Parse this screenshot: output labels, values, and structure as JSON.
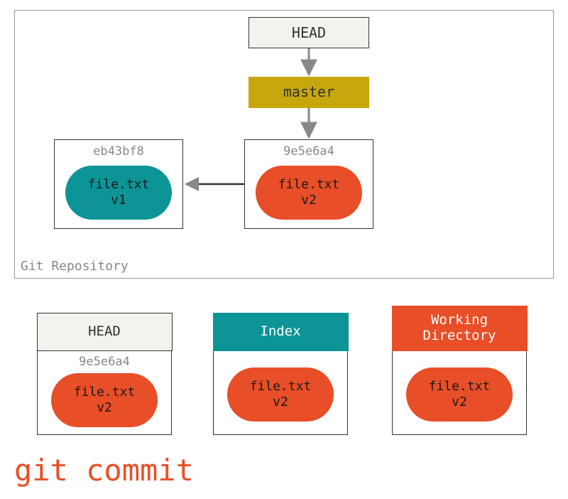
{
  "repo": {
    "label": "Git Repository",
    "head_label": "HEAD",
    "master_label": "master",
    "commits": [
      {
        "hash": "eb43bf8",
        "file": "file.txt",
        "version": "v1"
      },
      {
        "hash": "9e5e6a4",
        "file": "file.txt",
        "version": "v2"
      }
    ]
  },
  "areas": {
    "head": {
      "title": "HEAD",
      "hash": "9e5e6a4",
      "file": "file.txt",
      "version": "v2"
    },
    "index": {
      "title": "Index",
      "file": "file.txt",
      "version": "v2"
    },
    "wd": {
      "title_line1": "Working",
      "title_line2": "Directory",
      "file": "file.txt",
      "version": "v2"
    }
  },
  "command": "git commit",
  "colors": {
    "orange": "#e84e27",
    "teal": "#0d9497",
    "mustard": "#c8a70e",
    "cream": "#f3f2ed"
  }
}
